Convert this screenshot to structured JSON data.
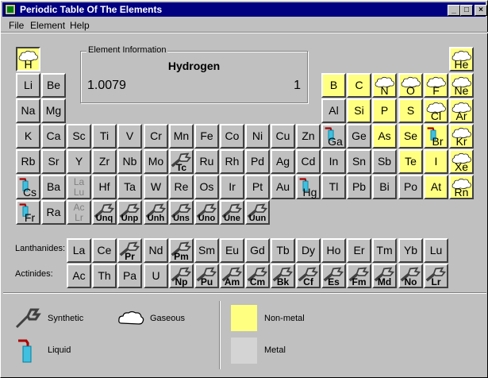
{
  "window": {
    "title": "Periodic Table Of The Elements",
    "min_glyph": "_",
    "max_glyph": "□",
    "close_glyph": "×"
  },
  "menu": [
    "File",
    "Element",
    "Help"
  ],
  "info": {
    "legend": "Element Information",
    "name": "Hydrogen",
    "weight": "1.0079",
    "number": "1"
  },
  "row_labels": {
    "lanthanides": "Lanthanides:",
    "actinides": "Actinides:"
  },
  "legend": {
    "synthetic": "Synthetic",
    "gaseous": "Gaseous",
    "liquid": "Liquid",
    "nonmetal": "Non-metal",
    "metal": "Metal"
  },
  "colors": {
    "nonmetal": "#ffff80",
    "metal": "#c0c0c0",
    "title": "#000080"
  },
  "elements": [
    {
      "s": "H",
      "c": 1,
      "r": 1,
      "t": "g",
      "nm": 1,
      "sel": 1
    },
    {
      "s": "He",
      "c": 18,
      "r": 1,
      "t": "g",
      "nm": 1
    },
    {
      "s": "Li",
      "c": 1,
      "r": 2
    },
    {
      "s": "Be",
      "c": 2,
      "r": 2
    },
    {
      "s": "B",
      "c": 13,
      "r": 2,
      "nm": 1
    },
    {
      "s": "C",
      "c": 14,
      "r": 2,
      "nm": 1
    },
    {
      "s": "N",
      "c": 15,
      "r": 2,
      "t": "g",
      "nm": 1
    },
    {
      "s": "O",
      "c": 16,
      "r": 2,
      "t": "g",
      "nm": 1
    },
    {
      "s": "F",
      "c": 17,
      "r": 2,
      "t": "g",
      "nm": 1
    },
    {
      "s": "Ne",
      "c": 18,
      "r": 2,
      "t": "g",
      "nm": 1
    },
    {
      "s": "Na",
      "c": 1,
      "r": 3
    },
    {
      "s": "Mg",
      "c": 2,
      "r": 3
    },
    {
      "s": "Al",
      "c": 13,
      "r": 3
    },
    {
      "s": "Si",
      "c": 14,
      "r": 3,
      "nm": 1
    },
    {
      "s": "P",
      "c": 15,
      "r": 3,
      "nm": 1
    },
    {
      "s": "S",
      "c": 16,
      "r": 3,
      "nm": 1
    },
    {
      "s": "Cl",
      "c": 17,
      "r": 3,
      "t": "g",
      "nm": 1
    },
    {
      "s": "Ar",
      "c": 18,
      "r": 3,
      "t": "g",
      "nm": 1
    },
    {
      "s": "K",
      "c": 1,
      "r": 4
    },
    {
      "s": "Ca",
      "c": 2,
      "r": 4
    },
    {
      "s": "Sc",
      "c": 3,
      "r": 4
    },
    {
      "s": "Ti",
      "c": 4,
      "r": 4
    },
    {
      "s": "V",
      "c": 5,
      "r": 4
    },
    {
      "s": "Cr",
      "c": 6,
      "r": 4
    },
    {
      "s": "Mn",
      "c": 7,
      "r": 4
    },
    {
      "s": "Fe",
      "c": 8,
      "r": 4
    },
    {
      "s": "Co",
      "c": 9,
      "r": 4
    },
    {
      "s": "Ni",
      "c": 10,
      "r": 4
    },
    {
      "s": "Cu",
      "c": 11,
      "r": 4
    },
    {
      "s": "Zn",
      "c": 12,
      "r": 4
    },
    {
      "s": "Ga",
      "c": 13,
      "r": 4,
      "t": "l"
    },
    {
      "s": "Ge",
      "c": 14,
      "r": 4
    },
    {
      "s": "As",
      "c": 15,
      "r": 4,
      "nm": 1
    },
    {
      "s": "Se",
      "c": 16,
      "r": 4,
      "nm": 1
    },
    {
      "s": "Br",
      "c": 17,
      "r": 4,
      "t": "l",
      "nm": 1
    },
    {
      "s": "Kr",
      "c": 18,
      "r": 4,
      "t": "g",
      "nm": 1
    },
    {
      "s": "Rb",
      "c": 1,
      "r": 5
    },
    {
      "s": "Sr",
      "c": 2,
      "r": 5
    },
    {
      "s": "Y",
      "c": 3,
      "r": 5
    },
    {
      "s": "Zr",
      "c": 4,
      "r": 5
    },
    {
      "s": "Nb",
      "c": 5,
      "r": 5
    },
    {
      "s": "Mo",
      "c": 6,
      "r": 5
    },
    {
      "s": "Tc",
      "c": 7,
      "r": 5,
      "t": "s"
    },
    {
      "s": "Ru",
      "c": 8,
      "r": 5
    },
    {
      "s": "Rh",
      "c": 9,
      "r": 5
    },
    {
      "s": "Pd",
      "c": 10,
      "r": 5
    },
    {
      "s": "Ag",
      "c": 11,
      "r": 5
    },
    {
      "s": "Cd",
      "c": 12,
      "r": 5
    },
    {
      "s": "In",
      "c": 13,
      "r": 5
    },
    {
      "s": "Sn",
      "c": 14,
      "r": 5
    },
    {
      "s": "Sb",
      "c": 15,
      "r": 5
    },
    {
      "s": "Te",
      "c": 16,
      "r": 5,
      "nm": 1
    },
    {
      "s": "I",
      "c": 17,
      "r": 5,
      "nm": 1
    },
    {
      "s": "Xe",
      "c": 18,
      "r": 5,
      "t": "g",
      "nm": 1
    },
    {
      "s": "Cs",
      "c": 1,
      "r": 6,
      "t": "l"
    },
    {
      "s": "Ba",
      "c": 2,
      "r": 6
    },
    {
      "s": "La\nLu",
      "c": 3,
      "r": 6,
      "dim": 1
    },
    {
      "s": "Hf",
      "c": 4,
      "r": 6
    },
    {
      "s": "Ta",
      "c": 5,
      "r": 6
    },
    {
      "s": "W",
      "c": 6,
      "r": 6
    },
    {
      "s": "Re",
      "c": 7,
      "r": 6
    },
    {
      "s": "Os",
      "c": 8,
      "r": 6
    },
    {
      "s": "Ir",
      "c": 9,
      "r": 6
    },
    {
      "s": "Pt",
      "c": 10,
      "r": 6
    },
    {
      "s": "Au",
      "c": 11,
      "r": 6
    },
    {
      "s": "Hg",
      "c": 12,
      "r": 6,
      "t": "l"
    },
    {
      "s": "Tl",
      "c": 13,
      "r": 6
    },
    {
      "s": "Pb",
      "c": 14,
      "r": 6
    },
    {
      "s": "Bi",
      "c": 15,
      "r": 6
    },
    {
      "s": "Po",
      "c": 16,
      "r": 6
    },
    {
      "s": "At",
      "c": 17,
      "r": 6,
      "nm": 1
    },
    {
      "s": "Rn",
      "c": 18,
      "r": 6,
      "t": "g",
      "nm": 1
    },
    {
      "s": "Fr",
      "c": 1,
      "r": 7,
      "t": "l"
    },
    {
      "s": "Ra",
      "c": 2,
      "r": 7
    },
    {
      "s": "Ac\nLr",
      "c": 3,
      "r": 7,
      "dim": 1
    },
    {
      "s": "Unq",
      "c": 4,
      "r": 7,
      "t": "s"
    },
    {
      "s": "Unp",
      "c": 5,
      "r": 7,
      "t": "s"
    },
    {
      "s": "Unh",
      "c": 6,
      "r": 7,
      "t": "s"
    },
    {
      "s": "Uns",
      "c": 7,
      "r": 7,
      "t": "s"
    },
    {
      "s": "Uno",
      "c": 8,
      "r": 7,
      "t": "s"
    },
    {
      "s": "Une",
      "c": 9,
      "r": 7,
      "t": "s"
    },
    {
      "s": "Uun",
      "c": 10,
      "r": 7,
      "t": "s"
    },
    {
      "s": "La",
      "c": 3,
      "r": 9
    },
    {
      "s": "Ce",
      "c": 4,
      "r": 9
    },
    {
      "s": "Pr",
      "c": 5,
      "r": 9,
      "t": "s"
    },
    {
      "s": "Nd",
      "c": 6,
      "r": 9
    },
    {
      "s": "Pm",
      "c": 7,
      "r": 9,
      "t": "s"
    },
    {
      "s": "Sm",
      "c": 8,
      "r": 9
    },
    {
      "s": "Eu",
      "c": 9,
      "r": 9
    },
    {
      "s": "Gd",
      "c": 10,
      "r": 9
    },
    {
      "s": "Tb",
      "c": 11,
      "r": 9
    },
    {
      "s": "Dy",
      "c": 12,
      "r": 9
    },
    {
      "s": "Ho",
      "c": 13,
      "r": 9
    },
    {
      "s": "Er",
      "c": 14,
      "r": 9
    },
    {
      "s": "Tm",
      "c": 15,
      "r": 9
    },
    {
      "s": "Yb",
      "c": 16,
      "r": 9
    },
    {
      "s": "Lu",
      "c": 17,
      "r": 9
    },
    {
      "s": "Ac",
      "c": 3,
      "r": 10
    },
    {
      "s": "Th",
      "c": 4,
      "r": 10
    },
    {
      "s": "Pa",
      "c": 5,
      "r": 10
    },
    {
      "s": "U",
      "c": 6,
      "r": 10
    },
    {
      "s": "Np",
      "c": 7,
      "r": 10,
      "t": "s"
    },
    {
      "s": "Pu",
      "c": 8,
      "r": 10,
      "t": "s"
    },
    {
      "s": "Am",
      "c": 9,
      "r": 10,
      "t": "s"
    },
    {
      "s": "Cm",
      "c": 10,
      "r": 10,
      "t": "s"
    },
    {
      "s": "Bk",
      "c": 11,
      "r": 10,
      "t": "s"
    },
    {
      "s": "Cf",
      "c": 12,
      "r": 10,
      "t": "s"
    },
    {
      "s": "Es",
      "c": 13,
      "r": 10,
      "t": "s"
    },
    {
      "s": "Fm",
      "c": 14,
      "r": 10,
      "t": "s"
    },
    {
      "s": "Md",
      "c": 15,
      "r": 10,
      "t": "s"
    },
    {
      "s": "No",
      "c": 16,
      "r": 10,
      "t": "s"
    },
    {
      "s": "Lr",
      "c": 17,
      "r": 10,
      "t": "s"
    }
  ]
}
